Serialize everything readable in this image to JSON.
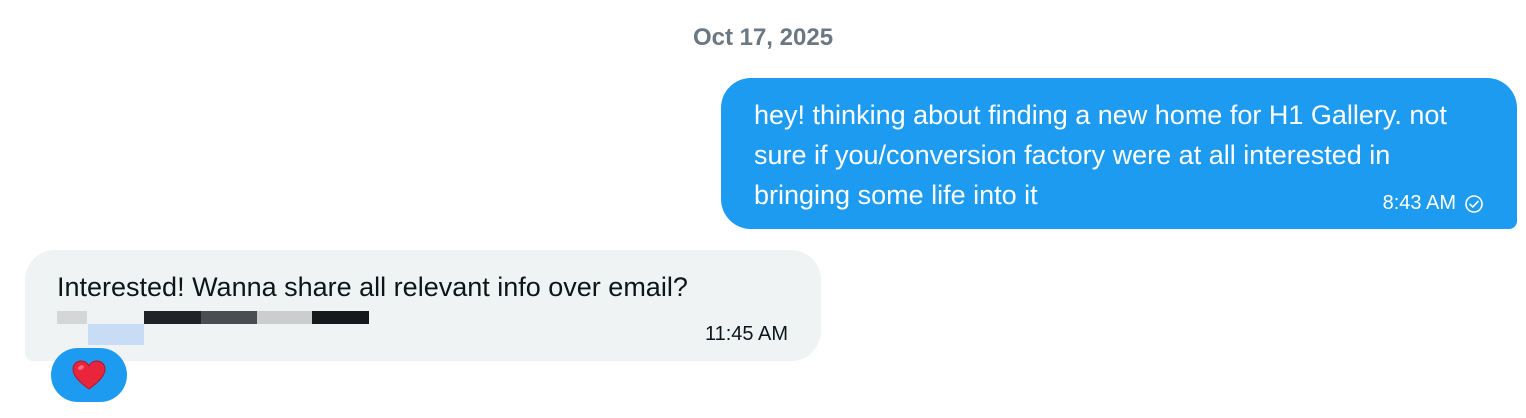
{
  "date_separator": "Oct 17, 2025",
  "messages": [
    {
      "direction": "outgoing",
      "text": "hey! thinking about finding a new home for H1 Gallery. not sure if you/conversion factory were at all interested in bringing some life into it",
      "time": "8:43 AM",
      "status_icon": "check-circle-icon"
    },
    {
      "direction": "incoming",
      "text": "Interested! Wanna share all relevant info over email?",
      "time": "11:45 AM",
      "redacted_content": true,
      "reaction": {
        "icon": "red-heart-icon"
      }
    }
  ],
  "colors": {
    "outgoing_bubble": "#1d9bf0",
    "incoming_bubble": "#eff3f4",
    "date_text": "#6b7782",
    "reaction_bg": "#1d9bf0",
    "heart": "#e8253b"
  }
}
